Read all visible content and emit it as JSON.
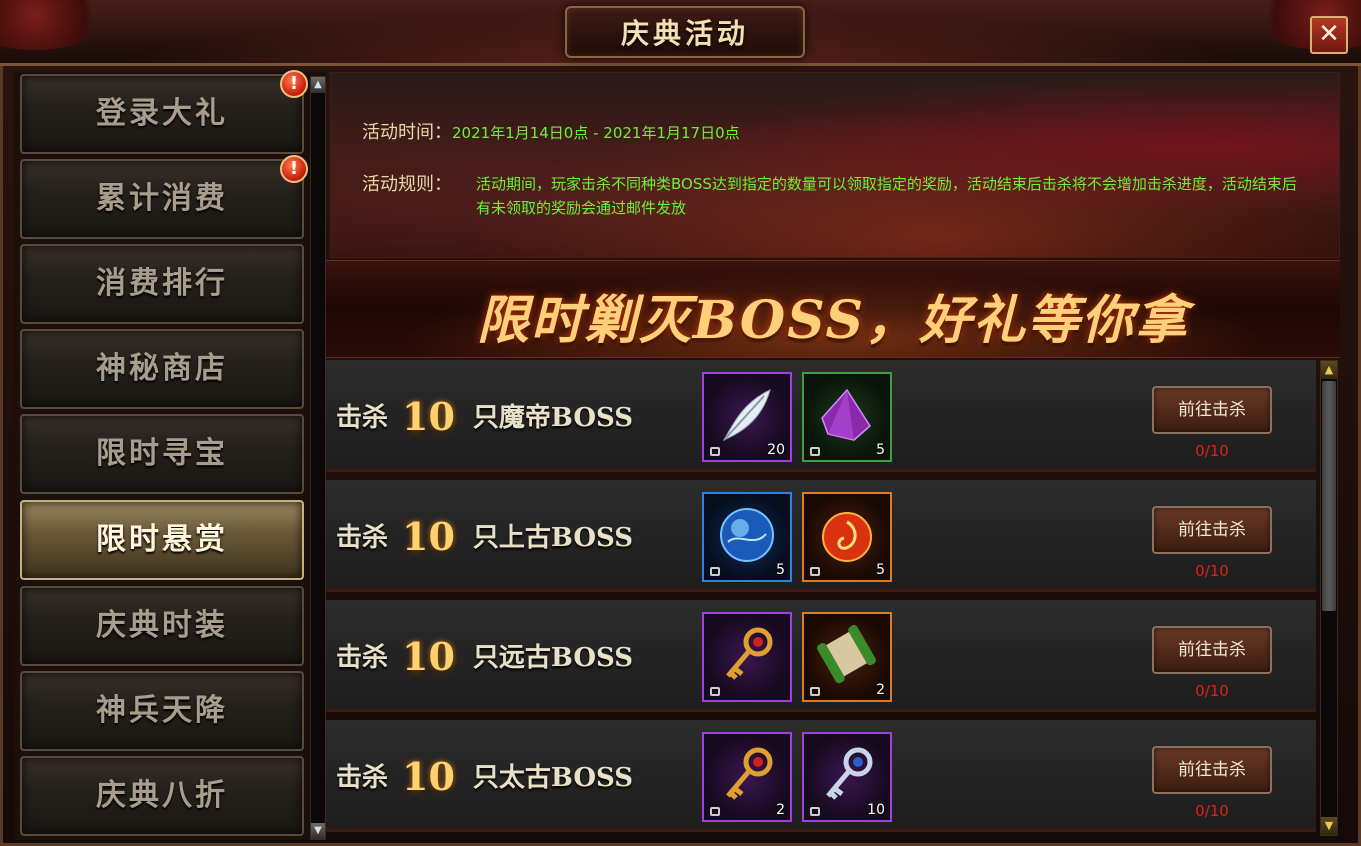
{
  "window": {
    "title": "庆典活动",
    "close_icon": "close-icon"
  },
  "sidebar": {
    "items": [
      {
        "label": "登录大礼",
        "badge": "!",
        "active": false
      },
      {
        "label": "累计消费",
        "badge": "!",
        "active": false
      },
      {
        "label": "消费排行",
        "active": false
      },
      {
        "label": "神秘商店",
        "active": false
      },
      {
        "label": "限时寻宝",
        "active": false
      },
      {
        "label": "限时悬赏",
        "active": true
      },
      {
        "label": "庆典时装",
        "active": false
      },
      {
        "label": "神兵天降",
        "active": false
      },
      {
        "label": "庆典八折",
        "active": false
      }
    ]
  },
  "info": {
    "time_label": "活动时间：",
    "time_value": "2021年1月14日0点 - 2021年1月17日0点",
    "rules_label": "活动规则：",
    "rules_value": "活动期间，玩家击杀不同种类BOSS达到指定的数量可以领取指定的奖励，活动结束后击杀将不会增加击杀进度，活动结束后有未领取的奖励会通过邮件发放"
  },
  "banner": {
    "slogan": "限时剿灭BOSS，好礼等你拿"
  },
  "tasks": [
    {
      "prefix": "击杀",
      "count": "10",
      "suffix": "只魔帝BOSS",
      "rewards": [
        {
          "icon": "feather-icon",
          "quality": "purple",
          "qty": "20"
        },
        {
          "icon": "crystal-shard-icon",
          "quality": "green",
          "qty": "5"
        }
      ],
      "button": "前往击杀",
      "progress": "0/10"
    },
    {
      "prefix": "击杀",
      "count": "10",
      "suffix": "只上古BOSS",
      "rewards": [
        {
          "icon": "blue-orb-icon",
          "quality": "blue",
          "qty": "5"
        },
        {
          "icon": "fire-orb-icon",
          "quality": "orange",
          "qty": "5"
        }
      ],
      "button": "前往击杀",
      "progress": "0/10"
    },
    {
      "prefix": "击杀",
      "count": "10",
      "suffix": "只远古BOSS",
      "rewards": [
        {
          "icon": "gold-key-icon",
          "quality": "purple",
          "qty": ""
        },
        {
          "icon": "scroll-icon",
          "quality": "orange",
          "qty": "2"
        }
      ],
      "button": "前往击杀",
      "progress": "0/10"
    },
    {
      "prefix": "击杀",
      "count": "10",
      "suffix": "只太古BOSS",
      "rewards": [
        {
          "icon": "gold-key-icon",
          "quality": "purple",
          "qty": "2"
        },
        {
          "icon": "silver-key-icon",
          "quality": "purple",
          "qty": "10"
        }
      ],
      "button": "前往击杀",
      "progress": "0/10"
    }
  ],
  "colors": {
    "accent_green": "#6ef03a",
    "progress_red": "#e0201a",
    "gold": "#ffd070"
  }
}
